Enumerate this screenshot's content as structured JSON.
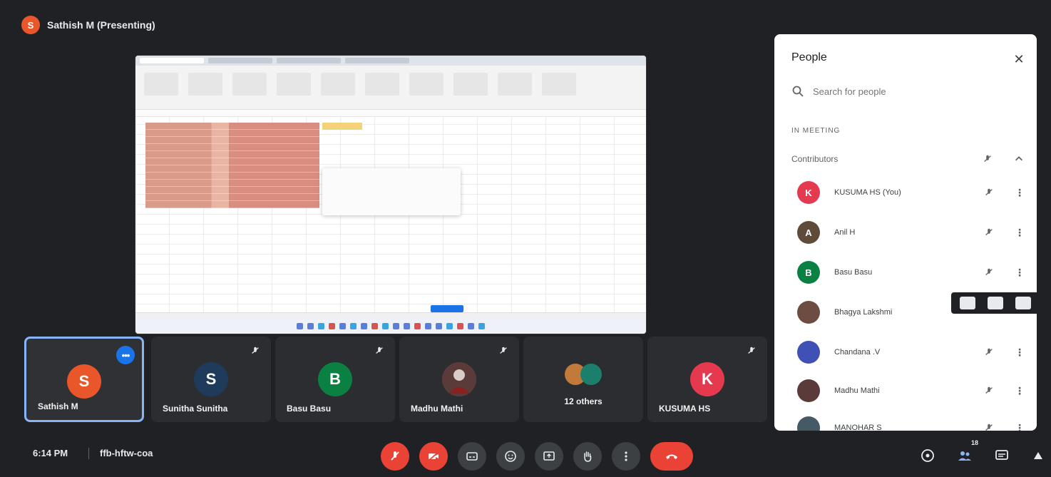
{
  "presenter": {
    "initial": "S",
    "label": "Sathish M (Presenting)"
  },
  "tiles": [
    {
      "name": "Sathish M",
      "initial": "S",
      "color": "#e8562a",
      "active": true
    },
    {
      "name": "Sunitha Sunitha",
      "initial": "S",
      "color": "#1f3b5c"
    },
    {
      "name": "Basu Basu",
      "initial": "B",
      "color": "#0b8043"
    },
    {
      "name": "Madhu Mathi",
      "initial": "",
      "color": "#5b3a3a"
    },
    {
      "name": "12 others",
      "initial": "",
      "color": "#7a5230",
      "group": true
    },
    {
      "name": "KUSUMA HS",
      "initial": "K",
      "color": "#e53950"
    }
  ],
  "people": {
    "title": "People",
    "search_placeholder": "Search for people",
    "section_label": "IN MEETING",
    "group_label": "Contributors",
    "members": [
      {
        "name": "KUSUMA HS (You)",
        "initial": "K",
        "color": "#e53950"
      },
      {
        "name": "Anil H",
        "initial": "A",
        "color": "#5f4b3a"
      },
      {
        "name": "Basu Basu",
        "initial": "B",
        "color": "#0b8043"
      },
      {
        "name": "Bhagya Lakshmi",
        "initial": "",
        "color": "#6d4c41"
      },
      {
        "name": "Chandana .V",
        "initial": "",
        "color": "#3f51b5"
      },
      {
        "name": "Madhu Mathi",
        "initial": "",
        "color": "#5b3a3a"
      },
      {
        "name": "MANOHAR S",
        "initial": "",
        "color": "#455a64"
      }
    ]
  },
  "bottom": {
    "time": "6:14 PM",
    "meeting_code": "ffb-hftw-coa",
    "people_count": "18"
  }
}
